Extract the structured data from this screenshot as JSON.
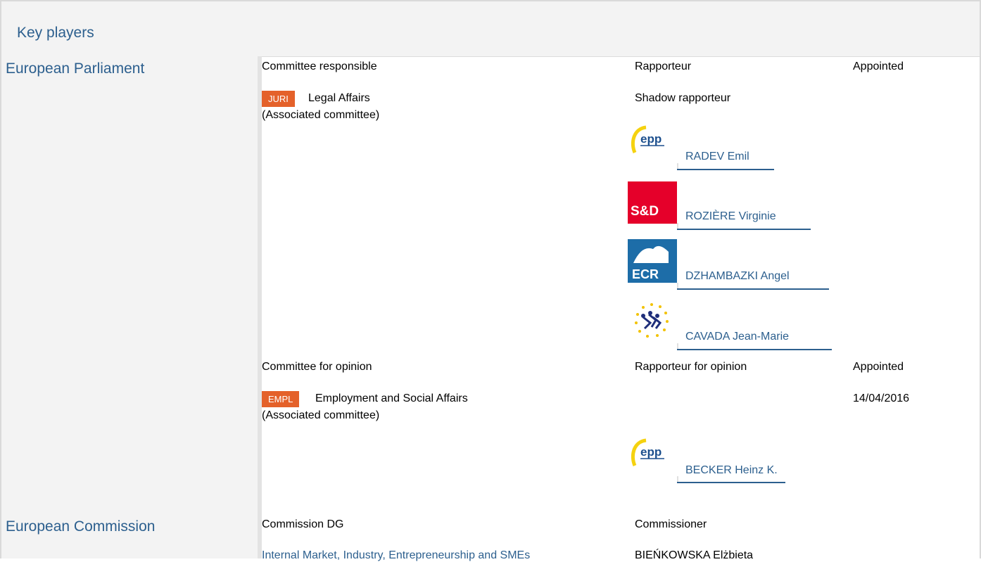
{
  "header": {
    "title": "Key players"
  },
  "parliament": {
    "title": "European Parliament",
    "responsible": {
      "col_committee": "Committee responsible",
      "col_rapporteur": "Rapporteur",
      "col_appointed": "Appointed",
      "badge": "JURI",
      "committee_name": "Legal Affairs",
      "associated": "(Associated committee)",
      "shadow_label": "Shadow rapporteur",
      "shadows": [
        {
          "name": "RADEV Emil",
          "group_icon": "epp-logo"
        },
        {
          "name": "ROZIÈRE Virginie",
          "group_icon": "sd-logo"
        },
        {
          "name": "DZHAMBAZKI Angel",
          "group_icon": "ecr-logo"
        },
        {
          "name": "CAVADA Jean-Marie",
          "group_icon": "alde-logo"
        }
      ]
    },
    "opinion": {
      "col_committee": "Committee for opinion",
      "col_rapporteur": "Rapporteur for opinion",
      "col_appointed": "Appointed",
      "badge": "EMPL",
      "committee_name": "Employment and Social Affairs",
      "associated": "(Associated committee)",
      "appointed_date": "14/04/2016",
      "rapporteur": {
        "name": "BECKER Heinz K.",
        "group_icon": "epp-logo"
      }
    }
  },
  "commission": {
    "title": "European Commission",
    "col_dg": "Commission DG",
    "col_commissioner": "Commissioner",
    "dg_name": "Internal Market, Industry, Entrepreneurship and SMEs",
    "commissioner": "BIEŃKOWSKA Elżbieta"
  },
  "colors": {
    "link": "#2c5f8e",
    "badge": "#e4612a",
    "panel": "#f3f3f3"
  }
}
